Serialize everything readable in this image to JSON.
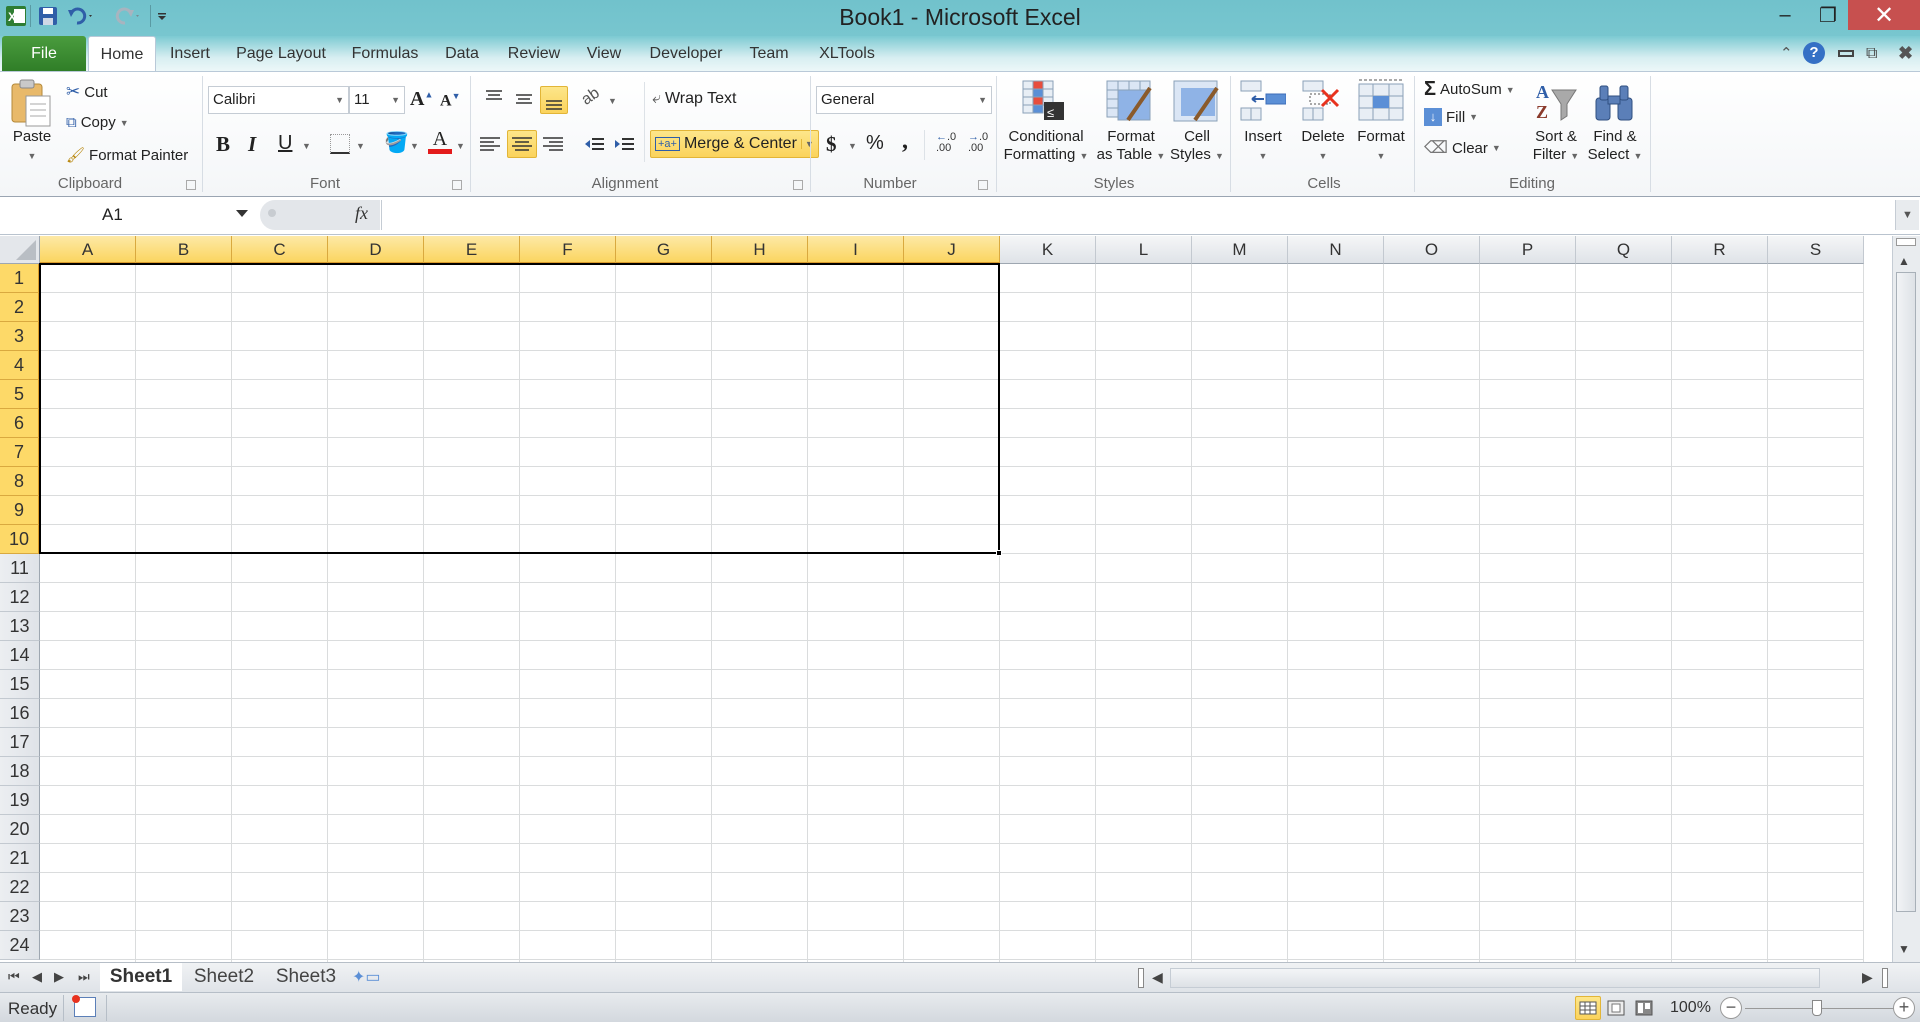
{
  "window": {
    "title": "Book1  -  Microsoft Excel",
    "controls": {
      "minimize": "–",
      "restore": "❐",
      "close": "✕"
    }
  },
  "quick_access": {
    "icons": [
      "excel-logo-icon",
      "save-icon",
      "undo-icon",
      "redo-icon",
      "customize-qat-icon"
    ]
  },
  "tabs": [
    {
      "label": "File"
    },
    {
      "label": "Home",
      "active": true
    },
    {
      "label": "Insert"
    },
    {
      "label": "Page Layout"
    },
    {
      "label": "Formulas"
    },
    {
      "label": "Data"
    },
    {
      "label": "Review"
    },
    {
      "label": "View"
    },
    {
      "label": "Developer"
    },
    {
      "label": "Team"
    },
    {
      "label": "XLTools"
    }
  ],
  "ribbon": {
    "clipboard": {
      "label": "Clipboard",
      "paste": "Paste",
      "cut": "Cut",
      "copy": "Copy",
      "format_painter": "Format Painter"
    },
    "font": {
      "label": "Font",
      "font_name": "Calibri",
      "font_size": "11",
      "bold": "B",
      "italic": "I",
      "underline": "U",
      "font_color": "#e31b1b"
    },
    "alignment": {
      "label": "Alignment",
      "wrap_text": "Wrap Text",
      "merge_center": "Merge & Center",
      "active_vertical": "bottom",
      "active_horizontal": "center"
    },
    "number": {
      "label": "Number",
      "format": "General",
      "currency": "$",
      "percent": "%",
      "comma": ",",
      "inc_decimal": "←.0 .00",
      "dec_decimal": "→.0 .00"
    },
    "styles": {
      "label": "Styles",
      "conditional_1": "Conditional",
      "conditional_2": "Formatting",
      "format_table_1": "Format",
      "format_table_2": "as Table",
      "cell_styles_1": "Cell",
      "cell_styles_2": "Styles"
    },
    "cells": {
      "label": "Cells",
      "insert": "Insert",
      "delete": "Delete",
      "format": "Format"
    },
    "editing": {
      "label": "Editing",
      "autosum": "AutoSum",
      "fill": "Fill",
      "clear": "Clear",
      "sort_1": "Sort &",
      "sort_2": "Filter",
      "find_1": "Find &",
      "find_2": "Select"
    }
  },
  "formula_bar": {
    "name_box": "A1",
    "fx": "fx",
    "formula": ""
  },
  "grid": {
    "columns": [
      "A",
      "B",
      "C",
      "D",
      "E",
      "F",
      "G",
      "H",
      "I",
      "J",
      "K",
      "L",
      "M",
      "N",
      "O",
      "P",
      "Q",
      "R",
      "S"
    ],
    "rows": [
      "1",
      "2",
      "3",
      "4",
      "5",
      "6",
      "7",
      "8",
      "9",
      "10",
      "11",
      "12",
      "13",
      "14",
      "15",
      "16",
      "17",
      "18",
      "19",
      "20",
      "21",
      "22",
      "23",
      "24"
    ],
    "selection": {
      "range": "A1:J10",
      "first_col": 0,
      "last_col": 9,
      "first_row": 0,
      "last_row": 9
    }
  },
  "sheets": {
    "tabs": [
      "Sheet1",
      "Sheet2",
      "Sheet3"
    ],
    "active": "Sheet1"
  },
  "status_bar": {
    "status": "Ready",
    "zoom": "100%",
    "zoom_value": 100
  },
  "colors": {
    "title_bar": "#71c2cc",
    "file_tab": "#2f7d27",
    "selection_header": "#fbd560",
    "close_button": "#c7504f"
  }
}
